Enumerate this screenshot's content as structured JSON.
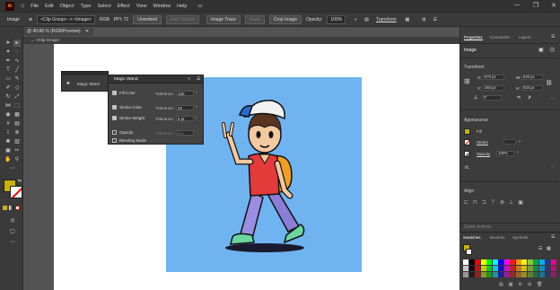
{
  "app": {
    "logo": "Ai"
  },
  "menu": [
    "File",
    "Edit",
    "Object",
    "Type",
    "Select",
    "Effect",
    "View",
    "Window",
    "Help"
  ],
  "window_controls": [
    "—",
    "❐",
    "✕"
  ],
  "control_bar": {
    "label": "Image",
    "selection": "<Clip Group> -> <Image>",
    "color_mode": "RGB",
    "ppi": "PPI: 72",
    "unembed": "Unembed",
    "edit_original": "Edit Original",
    "image_trace": "Image Trace",
    "mask": "Mask",
    "crop_image": "Crop Image",
    "opacity_label": "Opacity:",
    "opacity_value": "100%",
    "transform": "Transform"
  },
  "document": {
    "tab_title": "@ 40.86 % (RGB/Preview)",
    "breadcrumb": "<Clip Group>"
  },
  "magic_wand_tool_panel": {
    "label": "Magic Wand"
  },
  "magic_wand_panel": {
    "title": "Magic Wand",
    "rows": [
      {
        "label": "Fill Color",
        "checked": true,
        "tolerance_label": "Tolerance:",
        "tolerance": "100"
      },
      {
        "label": "Stroke Color",
        "checked": true,
        "tolerance_label": "Tolerance:",
        "tolerance": "32"
      },
      {
        "label": "Stroke Weight",
        "checked": true,
        "tolerance_label": "Tolerance:",
        "tolerance": "5 pt"
      },
      {
        "label": "Opacity",
        "checked": false,
        "tolerance_label": "Tolerance:",
        "tolerance": "5%"
      },
      {
        "label": "Blending Mode",
        "checked": false,
        "tolerance_label": "",
        "tolerance": ""
      }
    ]
  },
  "right_panel": {
    "tabs": [
      "Properties",
      "Comments",
      "Layers"
    ],
    "object_type": "Image",
    "transform": {
      "title": "Transform",
      "x_label": "X:",
      "x": "670 px",
      "w_label": "W:",
      "w": "620 px",
      "y_label": "Y:",
      "y": "384 px",
      "h_label": "H:",
      "h": "620 px",
      "angle_value": "0°"
    },
    "appearance": {
      "title": "Appearance",
      "fill_label": "Fill",
      "stroke_label": "Stroke",
      "opacity_label": "Opacity",
      "opacity_value": "100%"
    },
    "fx_label": "fx.",
    "align_title": "Align",
    "quick_actions_title": "Quick Actions",
    "swatches_tabs": [
      "Swatches",
      "Brushes",
      "Symbols"
    ]
  },
  "colors": {
    "artboard_bg": "#6fb4f1",
    "fill_swatch": "#c9b400",
    "swatch_row": [
      "#ffffff",
      "#000000",
      "#ff0000",
      "#ffff00",
      "#00ff00",
      "#00ffff",
      "#0000ff",
      "#ff00ff",
      "#ed1c24",
      "#f7941d",
      "#fff200",
      "#8dc63f",
      "#00a651",
      "#00aeef",
      "#2e3192",
      "#ec008c"
    ]
  }
}
